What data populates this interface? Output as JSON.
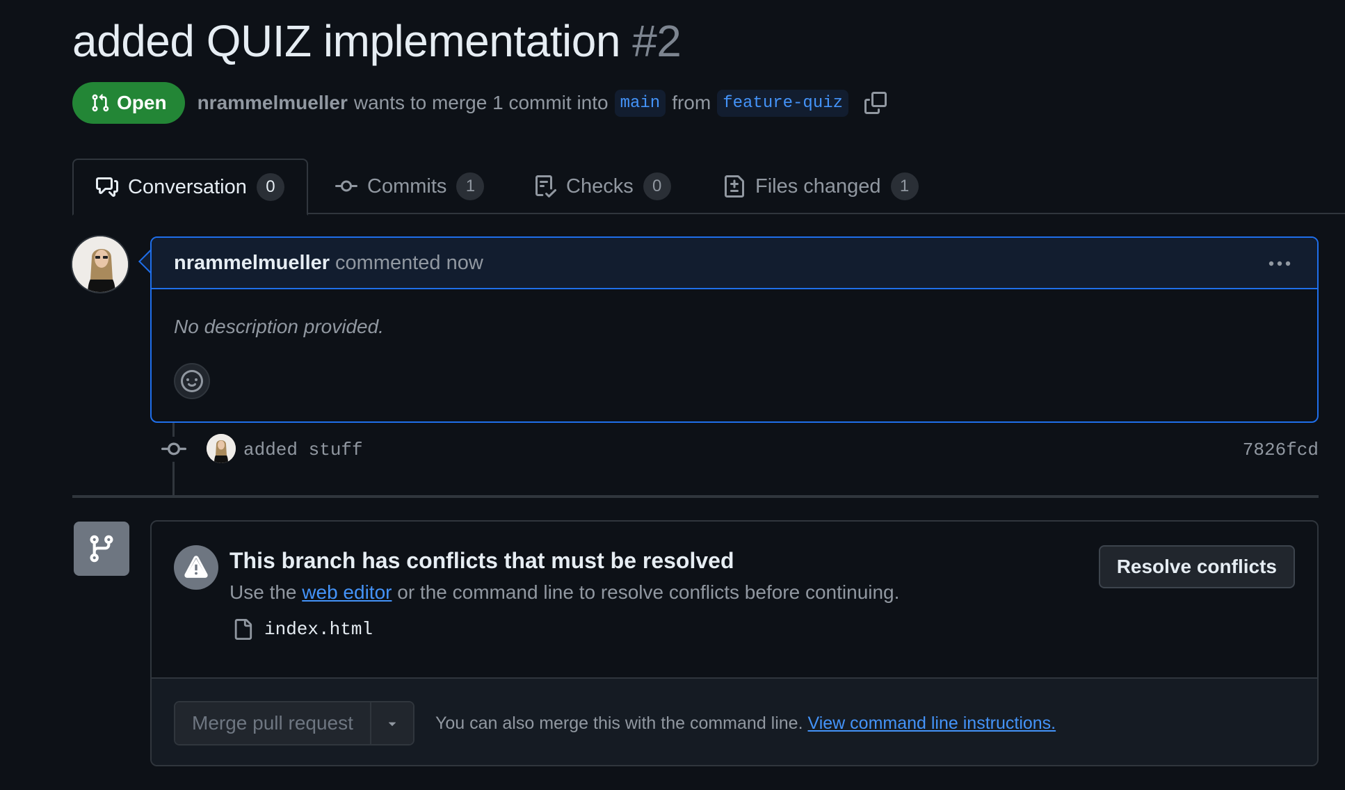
{
  "pr": {
    "title": "added QUIZ implementation",
    "number": "#2",
    "state": "Open",
    "author": "nrammelmueller",
    "merge_text_1": "wants to merge 1 commit into",
    "base_branch": "main",
    "merge_text_2": "from",
    "head_branch": "feature-quiz"
  },
  "tabs": [
    {
      "label": "Conversation",
      "count": "0",
      "icon": "comment-discussion-icon",
      "selected": true
    },
    {
      "label": "Commits",
      "count": "1",
      "icon": "git-commit-icon",
      "selected": false
    },
    {
      "label": "Checks",
      "count": "0",
      "icon": "checklist-icon",
      "selected": false
    },
    {
      "label": "Files changed",
      "count": "1",
      "icon": "file-diff-icon",
      "selected": false
    }
  ],
  "comment": {
    "author": "nrammelmueller",
    "meta": "commented now",
    "body": "No description provided."
  },
  "commit": {
    "message": "added stuff",
    "sha": "7826fcd"
  },
  "conflicts": {
    "title": "This branch has conflicts that must be resolved",
    "desc_prefix": "Use the",
    "desc_link": "web editor",
    "desc_suffix": "or the command line to resolve conflicts before continuing.",
    "file": "index.html",
    "resolve_label": "Resolve conflicts"
  },
  "merge": {
    "button_label": "Merge pull request",
    "hint": "You can also merge this with the command line.",
    "hint_link": "View command line instructions."
  },
  "colors": {
    "open_badge": "#238636",
    "link": "#4493f8",
    "focus_border": "#1f6feb",
    "background": "#0d1117"
  }
}
